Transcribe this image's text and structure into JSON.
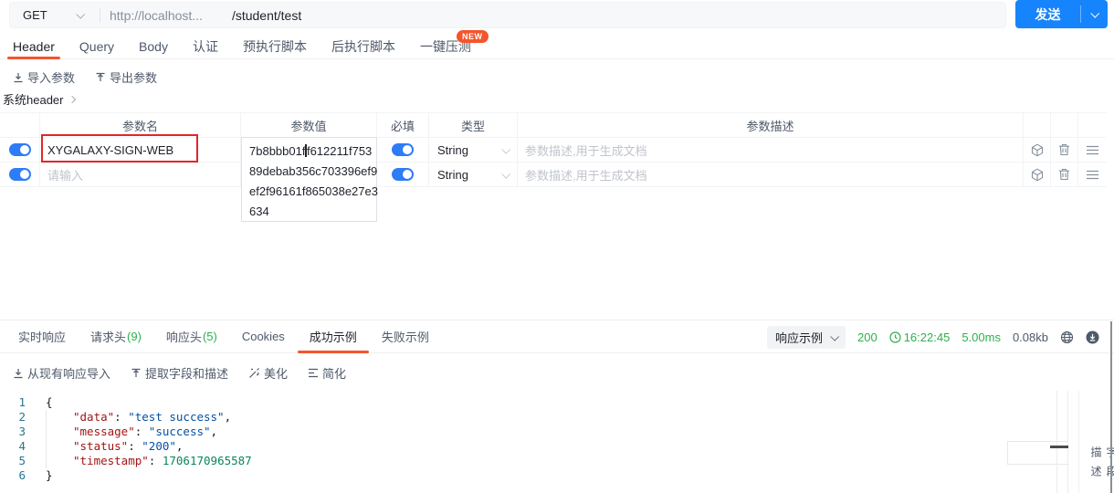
{
  "request": {
    "method": "GET",
    "url_host": "http://localhost...",
    "url_path": "/student/test",
    "send_label": "发送"
  },
  "request_tabs": {
    "tabs": [
      {
        "label": "Header"
      },
      {
        "label": "Query"
      },
      {
        "label": "Body"
      },
      {
        "label": "认证"
      },
      {
        "label": "预执行脚本"
      },
      {
        "label": "后执行脚本"
      },
      {
        "label": "一键压测"
      }
    ],
    "new_badge": "NEW"
  },
  "params_toolbar": {
    "import_label": "导入参数",
    "export_label": "导出参数"
  },
  "breadcrumb": {
    "label": "系统header"
  },
  "params_table": {
    "headers": {
      "name": "参数名",
      "value": "参数值",
      "required": "必填",
      "type": "类型",
      "description": "参数描述"
    },
    "rows": [
      {
        "name": "XYGALAXY-SIGN-WEB",
        "type": "String",
        "description_placeholder": "参数描述,用于生成文档"
      },
      {
        "name_placeholder": "请输入",
        "type": "String",
        "description_placeholder": "参数描述,用于生成文档"
      }
    ],
    "value_editor": {
      "before_caret": "7b8bbb01f",
      "after_caret": "f612211f753",
      "line2": "89debab356c703396ef9",
      "line3": "ef2f96161f865038e27e3",
      "line4": "634"
    }
  },
  "response_tabs": {
    "tabs": [
      {
        "label": "实时响应"
      },
      {
        "label": "请求头",
        "count": "(9)"
      },
      {
        "label": "响应头",
        "count": "(5)"
      },
      {
        "label": "Cookies"
      },
      {
        "label": "成功示例"
      },
      {
        "label": "失败示例"
      }
    ]
  },
  "response_meta": {
    "example_selector": "响应示例",
    "status_code": "200",
    "time": "16:22:45",
    "duration": "5.00ms",
    "size": "0.08kb"
  },
  "response_toolbar": {
    "import_label": "从现有响应导入",
    "extract_label": "提取字段和描述",
    "beautify_label": "美化",
    "simplify_label": "简化"
  },
  "editor": {
    "lines": [
      {
        "num": "1",
        "open": "{"
      },
      {
        "num": "2",
        "key": "\"data\"",
        "colon": ": ",
        "value": "\"test success\"",
        "comma": ","
      },
      {
        "num": "3",
        "key": "\"message\"",
        "colon": ": ",
        "value": "\"success\"",
        "comma": ","
      },
      {
        "num": "4",
        "key": "\"status\"",
        "colon": ": ",
        "value": "\"200\"",
        "comma": ","
      },
      {
        "num": "5",
        "key": "\"timestamp\"",
        "colon": ": ",
        "value": "1706170965587"
      },
      {
        "num": "6",
        "close": "}"
      }
    ]
  },
  "side_panel": {
    "vertical_label": "字段描述"
  },
  "colors": {
    "accent_orange": "#F5552D",
    "send_blue": "#1684FC",
    "toggle_blue": "#2E7CF6",
    "success_green": "#2EB04C",
    "highlight_red": "#E0262B",
    "editor_key": "#A31515",
    "editor_string": "#0451A5",
    "editor_number": "#098658"
  }
}
